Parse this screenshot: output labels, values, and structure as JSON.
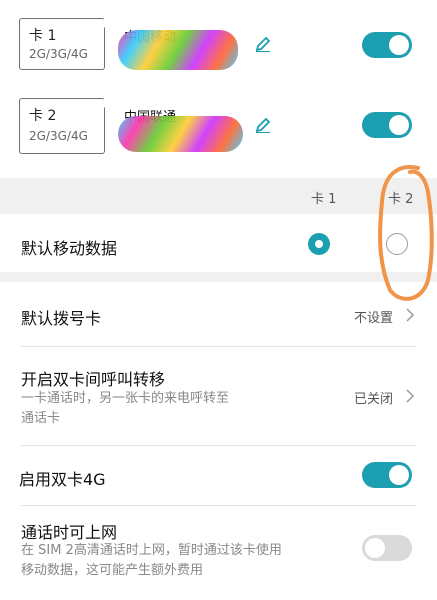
{
  "sims": [
    {
      "slot_label": "卡 1",
      "network": "2G/3G/4G",
      "carrier": "中国移动",
      "enabled": true
    },
    {
      "slot_label": "卡 2",
      "network": "2G/3G/4G",
      "carrier": "中国联通",
      "enabled": true
    }
  ],
  "mobile_data": {
    "col1": "卡 1",
    "col2": "卡 2",
    "title": "默认移动数据",
    "selected": "卡 1"
  },
  "default_dial": {
    "title": "默认拨号卡",
    "value": "不设置"
  },
  "call_forward": {
    "title": "开启双卡间呼叫转移",
    "subtitle_line1": "一卡通话时，另一张卡的来电呼转至",
    "subtitle_line2": "通话卡",
    "value": "已关闭"
  },
  "dual_4g": {
    "title": "启用双卡4G",
    "enabled": true
  },
  "data_during_call": {
    "title": "通话时可上网",
    "subtitle_line1": "在 SIM 2高清通话时上网，暂时通过该卡使用",
    "subtitle_line2": "移动数据，这可能产生额外费用",
    "enabled": false
  },
  "colors": {
    "accent": "#1b9fb1",
    "annotation": "#f0944a"
  }
}
